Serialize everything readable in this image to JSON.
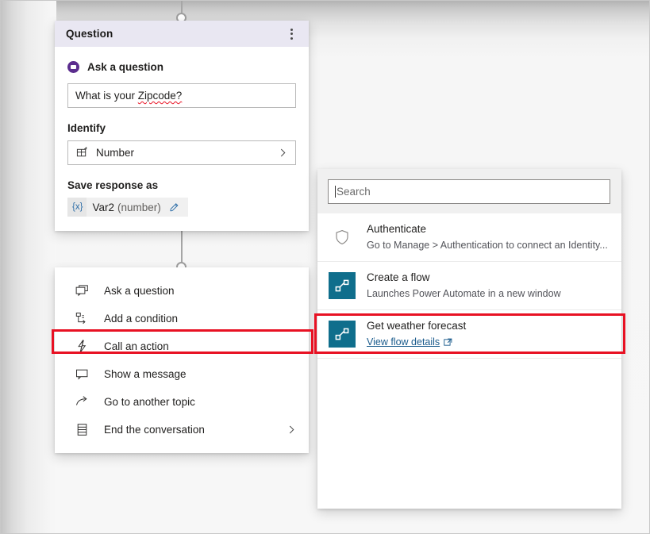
{
  "question_card": {
    "title": "Question",
    "more_icon": "more-vertical-icon",
    "ask_option_label": "Ask a question",
    "question_text": "What is your Zipcode?",
    "question_misspelled_word": "Zipcode?",
    "identify_label": "Identify",
    "identify_value": "Number",
    "identify_icon": "entity-grid-icon",
    "identify_chevron": "chevron-right-icon",
    "save_response_label": "Save response as",
    "variable_token": "{x}",
    "variable_name": "Var2",
    "variable_type": "(number)",
    "edit_icon": "pencil-icon"
  },
  "node_menu": {
    "items": [
      {
        "label": "Ask a question",
        "icon": "question-bubble-icon",
        "has_chevron": false,
        "highlighted": false
      },
      {
        "label": "Add a condition",
        "icon": "branch-condition-icon",
        "has_chevron": false,
        "highlighted": false
      },
      {
        "label": "Call an action",
        "icon": "lightning-bolt-icon",
        "has_chevron": false,
        "highlighted": true
      },
      {
        "label": "Show a message",
        "icon": "message-bubble-icon",
        "has_chevron": false,
        "highlighted": false
      },
      {
        "label": "Go to another topic",
        "icon": "redirect-arrow-icon",
        "has_chevron": false,
        "highlighted": false
      },
      {
        "label": "End the conversation",
        "icon": "end-conversation-icon",
        "has_chevron": true,
        "highlighted": false
      }
    ]
  },
  "action_panel": {
    "search_placeholder": "Search",
    "search_value": "",
    "items": [
      {
        "title": "Authenticate",
        "subtitle": "Go to Manage > Authentication to connect an Identity...",
        "icon": "shield-icon",
        "icon_kind": "outline",
        "link": null,
        "highlighted": false
      },
      {
        "title": "Create a flow",
        "subtitle": "Launches Power Automate in a new window",
        "icon": "flow-icon",
        "icon_kind": "tile",
        "link": null,
        "highlighted": false
      },
      {
        "title": "Get weather forecast",
        "subtitle": null,
        "icon": "flow-icon",
        "icon_kind": "tile",
        "link": "View flow details",
        "link_icon": "open-in-new-window-icon",
        "highlighted": true
      }
    ]
  },
  "colors": {
    "card_header": "#E9E7F2",
    "accent_purple": "#5B2D8E",
    "flow_teal": "#0F6E8C",
    "highlight_red": "#E81123",
    "link_blue": "#1A5B8C",
    "canvas_gray": "#F7F7F7"
  }
}
